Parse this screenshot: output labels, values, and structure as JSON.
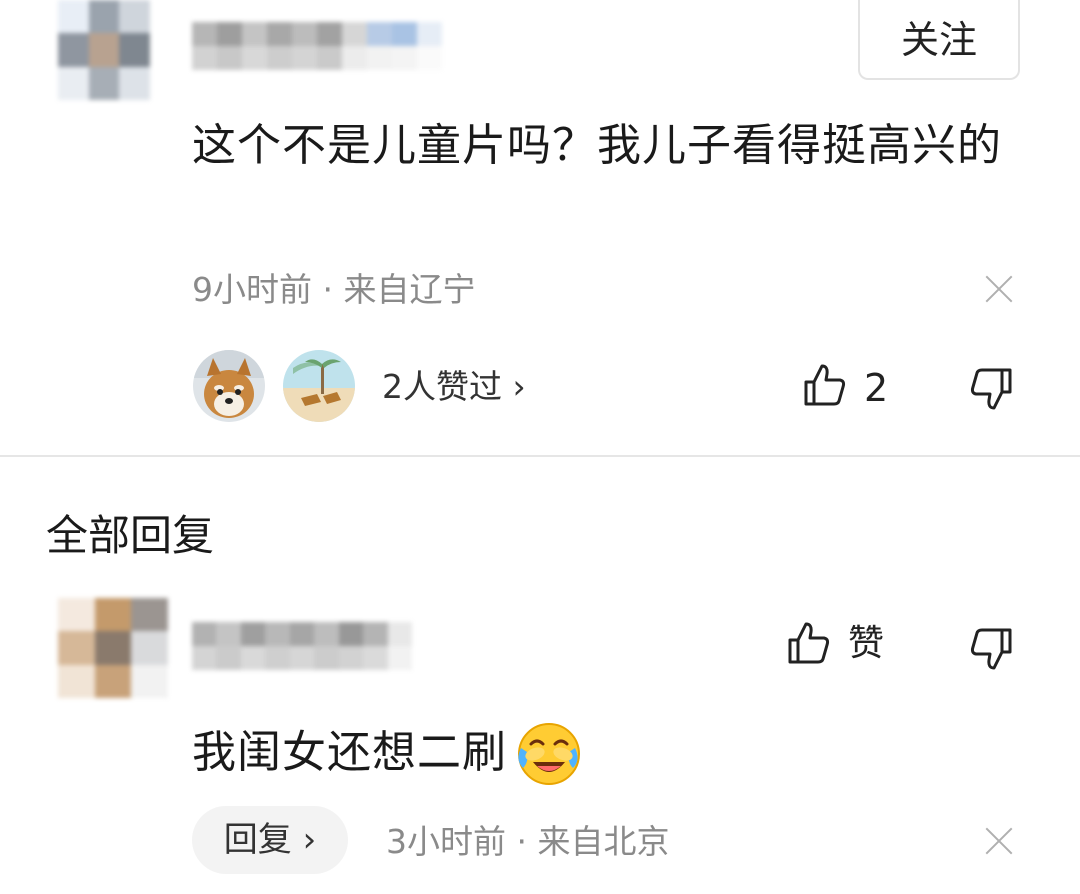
{
  "comment": {
    "follow_label": "关注",
    "text": "这个不是儿童片吗？我儿子看得挺高兴的",
    "meta": "9小时前 · 来自辽宁",
    "likers_summary": "2人赞过 ›",
    "like_count": "2"
  },
  "replies_section": {
    "title": "全部回复"
  },
  "reply": {
    "like_label": "赞",
    "text": "我闺女还想二刷",
    "emoji": "crying-laughing-emoji",
    "reply_button": "回复 ›",
    "meta": "3小时前 · 来自北京"
  },
  "icons": {
    "thumb_up": "thumb-up-icon",
    "thumb_down": "thumb-down-icon",
    "close": "close-icon"
  },
  "colors": {
    "text": "#1a1a1a",
    "meta": "#8a8a8a",
    "divider": "#e6e6e6",
    "pill_bg": "#f3f3f3"
  }
}
